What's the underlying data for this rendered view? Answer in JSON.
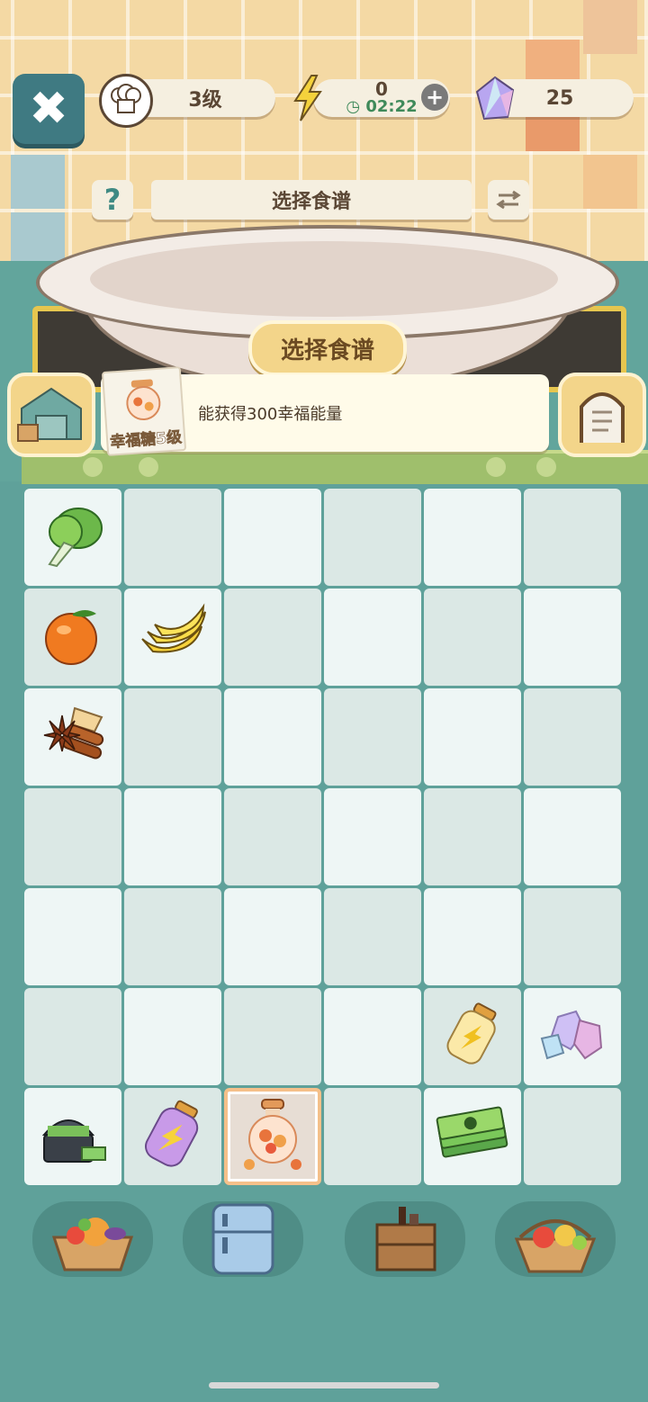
{
  "hud": {
    "level_text": "3级",
    "energy_value": "0",
    "energy_timer": "02:22",
    "gems_value": "25",
    "icons": {
      "close": "close-icon",
      "chef": "chef-hat-icon",
      "energy": "lightning-icon",
      "clock": "clock-icon",
      "plus": "plus-icon",
      "gem": "gem-icon"
    }
  },
  "recipe": {
    "help_label": "?",
    "title": "选择食谱",
    "badge_label": "选择食谱",
    "reward_text": "能获得300幸福能量",
    "thumb_caption": "幸福糖5级"
  },
  "grid": {
    "rows": 7,
    "cols": 6,
    "items": [
      {
        "row": 0,
        "col": 0,
        "name": "bok-choy-icon"
      },
      {
        "row": 1,
        "col": 0,
        "name": "orange-icon"
      },
      {
        "row": 1,
        "col": 1,
        "name": "banana-icon"
      },
      {
        "row": 2,
        "col": 0,
        "name": "star-anise-cinnamon-icon"
      },
      {
        "row": 5,
        "col": 4,
        "name": "yellow-energy-jar-icon"
      },
      {
        "row": 5,
        "col": 5,
        "name": "crystal-gems-icon"
      },
      {
        "row": 6,
        "col": 0,
        "name": "treasure-chest-icon"
      },
      {
        "row": 6,
        "col": 1,
        "name": "purple-energy-jar-icon"
      },
      {
        "row": 6,
        "col": 2,
        "name": "candy-jar-icon",
        "selected": true
      },
      {
        "row": 6,
        "col": 4,
        "name": "cash-stack-icon"
      }
    ]
  },
  "bottom_bar": [
    "vegetable-basket-icon",
    "refrigerator-icon",
    "cabinet-icon",
    "fruit-basket-icon"
  ],
  "colors": {
    "accent": "#3f7a82",
    "background": "#5fa19a",
    "badge": "#f3d58a"
  }
}
